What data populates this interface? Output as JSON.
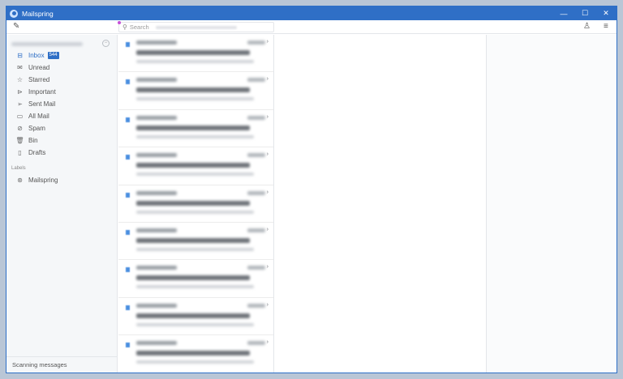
{
  "window": {
    "title": "Mailspring"
  },
  "toolbar": {
    "search_placeholder": "Search"
  },
  "sidebar": {
    "items": [
      {
        "label": "Inbox",
        "icon": "inbox-icon",
        "glyph": "⊟",
        "badge": "544",
        "active": true
      },
      {
        "label": "Unread",
        "icon": "unread-icon",
        "glyph": "✉"
      },
      {
        "label": "Starred",
        "icon": "star-icon",
        "glyph": "☆"
      },
      {
        "label": "Important",
        "icon": "important-icon",
        "glyph": "⊳"
      },
      {
        "label": "Sent Mail",
        "icon": "sent-icon",
        "glyph": "➢"
      },
      {
        "label": "All Mail",
        "icon": "folder-icon",
        "glyph": "▭"
      },
      {
        "label": "Spam",
        "icon": "spam-icon",
        "glyph": "⊘"
      },
      {
        "label": "Bin",
        "icon": "bin-icon",
        "glyph": "🗑"
      },
      {
        "label": "Drafts",
        "icon": "draft-icon",
        "glyph": "▯"
      }
    ],
    "labels_heading": "Labels",
    "labels": [
      {
        "label": "Mailspring",
        "icon": "tag-icon",
        "glyph": "⊛"
      }
    ]
  },
  "status": {
    "text": "Scanning messages"
  },
  "colors": {
    "accent": "#2f6fc6",
    "titlebar": "#2f6fc6"
  }
}
